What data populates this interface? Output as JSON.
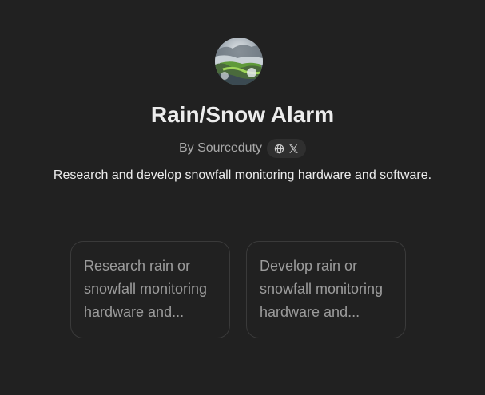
{
  "gpt": {
    "name": "Rain/Snow Alarm",
    "author": "By Sourceduty",
    "description": "Research and develop snowfall monitoring hardware and software.",
    "avatar_icon": "landscape-avatar-icon",
    "social_icons": [
      "globe-icon",
      "x-logo-icon"
    ]
  },
  "conversation_starters": [
    {
      "text": "Research rain or snowfall monitoring hardware and..."
    },
    {
      "text": "Develop rain or snowfall monitoring hardware and..."
    }
  ],
  "colors": {
    "background": "#212121",
    "text_primary": "#ececec",
    "text_secondary": "#a8a8a8",
    "starter_text": "#9b9b9b",
    "starter_border": "#3a3a3a",
    "pill_background": "#2f2f2f"
  }
}
